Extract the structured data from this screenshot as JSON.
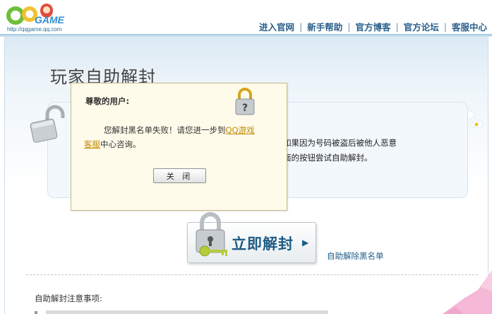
{
  "header": {
    "logo_url_text": "http://qqgame.qq.com",
    "nav": [
      {
        "label": "进入官网"
      },
      {
        "label": "新手帮助"
      },
      {
        "label": "官方博客"
      },
      {
        "label": "官方论坛"
      },
      {
        "label": "客服中心"
      }
    ]
  },
  "page": {
    "title": "玩家自助解封",
    "info_lines": [
      "如果因为号码被盗后被他人恶意",
      "面的按钮尝试自助解封。"
    ],
    "unlock_button_label": "立即解封",
    "blacklist_link": "自助解除黑名单",
    "notes_title": "自助解封注意事项:"
  },
  "dialog": {
    "title": "尊敬的用户:",
    "message_before": "您解封黑名单失败！请您进一步到",
    "link_1": "QQ游戏",
    "link_2": "客服",
    "message_after": "中心咨询。",
    "close_button": "关 闭"
  },
  "colors": {
    "nav_text": "#2a5f8c",
    "dialog_bg": "#fffbea",
    "link_gold": "#c08a00",
    "button_text": "#1f5d86"
  },
  "icons": [
    "lock-icon",
    "key-icon",
    "daisy-flowers",
    "qqgame-logo"
  ]
}
